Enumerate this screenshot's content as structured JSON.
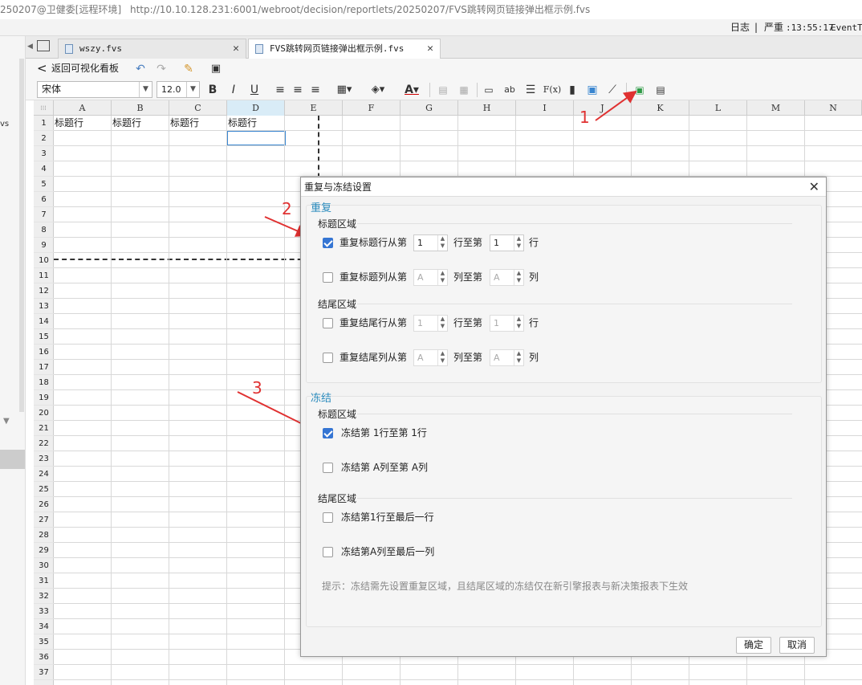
{
  "window": {
    "title_left": "250207@卫健委[远程环境]",
    "url": "http://10.10.128.231:6001/webroot/decision/reportlets/20250207/FVS跳转网页链接弹出框示例.fvs"
  },
  "status": {
    "log": "日志",
    "sep": "|",
    "severity": "严重",
    "time": ":13:55:17",
    "event": "EventTI"
  },
  "left_panel": {
    "fragment": "vs"
  },
  "tabs": [
    {
      "label": "wszy.fvs",
      "active": false
    },
    {
      "label": "FVS跳转网页链接弹出框示例.fvs",
      "active": true
    }
  ],
  "toolbar": {
    "back_label": "返回可视化看板",
    "font_name": "宋体",
    "font_size": "12.0",
    "bold": "B",
    "italic": "I",
    "underline": "U",
    "text_color": "A",
    "ab": "ab",
    "fx": "F(x)"
  },
  "sheet": {
    "columns": [
      "A",
      "B",
      "C",
      "D",
      "E",
      "F",
      "G",
      "H",
      "I",
      "J",
      "K",
      "L",
      "M",
      "N"
    ],
    "selected_column": "D",
    "rows": [
      "1",
      "2",
      "3",
      "4",
      "5",
      "6",
      "7",
      "8",
      "9",
      "10",
      "11",
      "12",
      "13",
      "14",
      "15",
      "16",
      "17",
      "18",
      "19",
      "20",
      "21",
      "22",
      "23",
      "24",
      "25",
      "26",
      "27",
      "28",
      "29",
      "30",
      "31",
      "32",
      "33",
      "34",
      "35",
      "36",
      "37"
    ],
    "row1_cells": [
      "标题行",
      "标题行",
      "标题行",
      "标题行"
    ]
  },
  "dialog": {
    "title": "重复与冻结设置",
    "repeat": {
      "section": "重复",
      "title_area": "标题区域",
      "footer_area": "结尾区域",
      "rows": [
        {
          "label": "重复标题行从第",
          "checked": true,
          "from": "1",
          "mid": "行至第",
          "to": "1",
          "unit": "行",
          "enabled": true
        },
        {
          "label": "重复标题列从第",
          "checked": false,
          "from": "A",
          "mid": "列至第",
          "to": "A",
          "unit": "列",
          "enabled": false
        },
        {
          "label": "重复结尾行从第",
          "checked": false,
          "from": "1",
          "mid": "行至第",
          "to": "1",
          "unit": "行",
          "enabled": false
        },
        {
          "label": "重复结尾列从第",
          "checked": false,
          "from": "A",
          "mid": "列至第",
          "to": "A",
          "unit": "列",
          "enabled": false
        }
      ]
    },
    "freeze": {
      "section": "冻结",
      "title_area": "标题区域",
      "footer_area": "结尾区域",
      "items": [
        {
          "label": "冻结第 1行至第 1行",
          "checked": true
        },
        {
          "label": "冻结第 A列至第 A列",
          "checked": false
        },
        {
          "label": "冻结第1行至最后一行",
          "checked": false
        },
        {
          "label": "冻结第A列至最后一列",
          "checked": false
        }
      ],
      "hint": "提示：冻结需先设置重复区域，且结尾区域的冻结仅在新引擎报表与新决策报表下生效"
    },
    "ok_label": "确定",
    "cancel_label": "取消"
  },
  "annotations": [
    "1",
    "2",
    "3"
  ],
  "colors": {
    "accent": "#3575d3",
    "section": "#2a8bbd",
    "annotation": "#e03131"
  }
}
